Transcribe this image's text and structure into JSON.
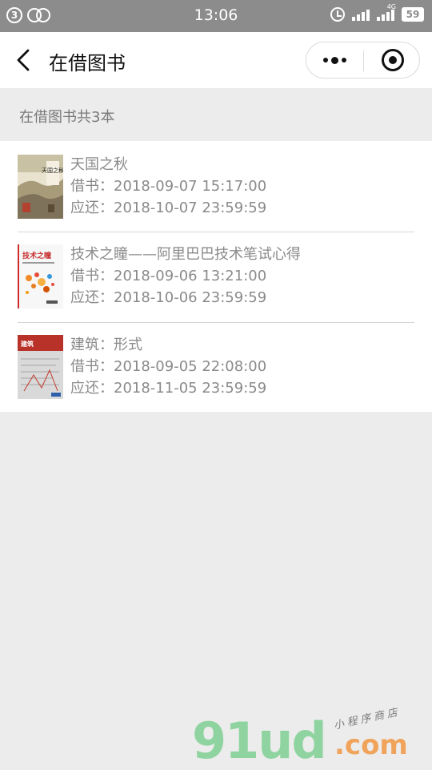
{
  "status_bar": {
    "notification_count": "3",
    "time": "13:06",
    "network_tag": "4G",
    "battery": "59"
  },
  "nav": {
    "title": "在借图书"
  },
  "summary": "在借图书共3本",
  "labels": {
    "borrowed": "借书：",
    "due": "应还："
  },
  "books": [
    {
      "title": "天国之秋",
      "borrowed": "2018-09-07 15:17:00",
      "due": "2018-10-07 23:59:59",
      "cover_title": "天国之秋"
    },
    {
      "title": "技术之瞳——阿里巴巴技术笔试心得",
      "borrowed": "2018-09-06 13:21:00",
      "due": "2018-10-06 23:59:59",
      "cover_title": "技术之瞳"
    },
    {
      "title": "建筑：形式",
      "borrowed": "2018-09-05 22:08:00",
      "due": "2018-11-05 23:59:59",
      "cover_title": "建筑"
    }
  ],
  "watermark": {
    "brand": "91ud",
    "domain": ".com",
    "tagline": "小程序商店"
  },
  "colors": {
    "status_bar": "#8c8c8c",
    "page_bg": "#ececec",
    "watermark_green": "#8fd4a0",
    "watermark_orange": "#f0a35a"
  }
}
